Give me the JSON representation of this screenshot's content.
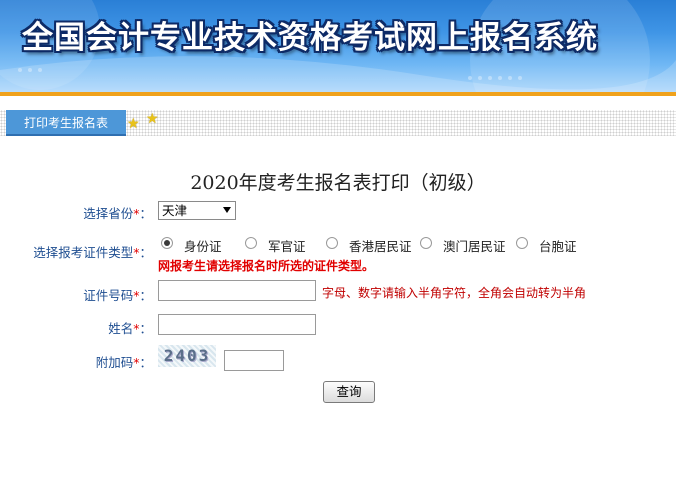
{
  "header": {
    "title": "全国会计专业技术资格考试网上报名系统"
  },
  "tabbar": {
    "active_tab": "打印考生报名表",
    "icon": "star-icon"
  },
  "form": {
    "title": "2020年度考生报名表打印（初级）",
    "province": {
      "label": "选择省份",
      "required_mark": "*",
      "selected": "天津"
    },
    "cert_type": {
      "label": "选择报考证件类型",
      "required_mark": "*",
      "options": [
        {
          "label": "身份证",
          "checked": true
        },
        {
          "label": "军官证",
          "checked": false
        },
        {
          "label": "香港居民证",
          "checked": false
        },
        {
          "label": "澳门居民证",
          "checked": false
        },
        {
          "label": "台胞证",
          "checked": false
        }
      ],
      "warning": "网报考生请选择报名时所选的证件类型。"
    },
    "cert_no": {
      "label": "证件号码",
      "required_mark": "*",
      "value": "",
      "hint": "字母、数字请输入半角字符，全角会自动转为半角"
    },
    "name": {
      "label": "姓名",
      "required_mark": "*",
      "value": ""
    },
    "captcha": {
      "label": "附加码",
      "required_mark": "*",
      "image_text": "2403",
      "value": ""
    },
    "submit_label": "查询"
  },
  "colors": {
    "label": "#1f4e91",
    "required": "#e10000",
    "tab": "#4d97d8",
    "banner_accent": "#f0a21c"
  }
}
